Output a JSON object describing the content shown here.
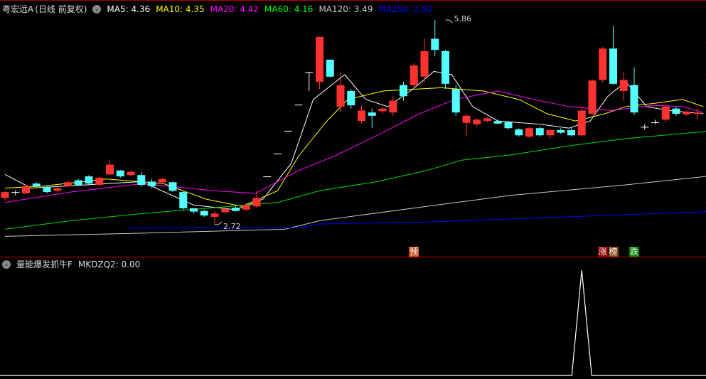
{
  "header": {
    "stock": "粤宏远A",
    "mode": "(日线 前复权)",
    "ma": [
      {
        "label": "MA5: 4.36",
        "color": "#ffffff"
      },
      {
        "label": "MA10: 4.35",
        "color": "#ffff00"
      },
      {
        "label": "MA20: 4.42",
        "color": "#ff00ff"
      },
      {
        "label": "MA60: 4.16",
        "color": "#00ff00"
      },
      {
        "label": "MA120: 3.49",
        "color": "#c8c8c8"
      },
      {
        "label": "MA250: 2.92",
        "color": "#0000ff"
      }
    ]
  },
  "indicator": {
    "name": "量能爆发抓牛F",
    "value_label": "MKDZQ2: 0.00",
    "series": {
      "spike_index": 55,
      "spike_value": 1
    }
  },
  "colors": {
    "up": "#ff3232",
    "down": "#54ffff"
  },
  "annotations": {
    "high": {
      "label": "5.86",
      "index": 42,
      "price": 5.86
    },
    "low": {
      "label": "2.72",
      "index": 20,
      "price": 2.72
    }
  },
  "markers": [
    {
      "label": "预",
      "index": 39,
      "color": "#c8501e"
    },
    {
      "label": "涨",
      "index": 57,
      "color": "#8b0000"
    },
    {
      "label": "榜",
      "index": 58,
      "color": "#8b4513"
    },
    {
      "label": "跌",
      "index": 60,
      "color": "#008000"
    }
  ],
  "chart_data": {
    "type": "candlestick",
    "price_range": [
      2.5,
      6.0
    ],
    "candles": [
      [
        3.13,
        3.22,
        3.24,
        3.09
      ],
      [
        3.22,
        3.22,
        3.25,
        3.17
      ],
      [
        3.2,
        3.31,
        3.33,
        3.18
      ],
      [
        3.35,
        3.31,
        3.37,
        3.3
      ],
      [
        3.3,
        3.22,
        3.31,
        3.2
      ],
      [
        3.24,
        3.28,
        3.3,
        3.22
      ],
      [
        3.31,
        3.37,
        3.4,
        3.3
      ],
      [
        3.4,
        3.33,
        3.42,
        3.31
      ],
      [
        3.46,
        3.35,
        3.48,
        3.33
      ],
      [
        3.33,
        3.44,
        3.46,
        3.31
      ],
      [
        3.49,
        3.64,
        3.71,
        3.48
      ],
      [
        3.55,
        3.46,
        3.56,
        3.44
      ],
      [
        3.48,
        3.53,
        3.55,
        3.46
      ],
      [
        3.48,
        3.33,
        3.53,
        3.3
      ],
      [
        3.38,
        3.31,
        3.42,
        3.28
      ],
      [
        3.37,
        3.42,
        3.44,
        3.35
      ],
      [
        3.37,
        3.24,
        3.38,
        3.22
      ],
      [
        3.22,
        2.97,
        3.24,
        2.95
      ],
      [
        2.97,
        2.92,
        2.98,
        2.89
      ],
      [
        2.93,
        2.86,
        2.95,
        2.84
      ],
      [
        2.84,
        2.89,
        2.93,
        2.72
      ],
      [
        2.91,
        2.96,
        2.98,
        2.89
      ],
      [
        2.98,
        2.93,
        3.0,
        2.92
      ],
      [
        2.95,
        3.02,
        3.04,
        2.93
      ],
      [
        3.0,
        3.13,
        3.24,
        2.98
      ],
      [
        3.46,
        3.46,
        3.46,
        3.46
      ],
      [
        3.81,
        3.81,
        3.81,
        3.81
      ],
      [
        4.16,
        4.16,
        4.16,
        4.16
      ],
      [
        4.56,
        4.56,
        4.56,
        4.56
      ],
      [
        5.06,
        5.06,
        5.06,
        4.77
      ],
      [
        4.91,
        5.6,
        5.6,
        4.8
      ],
      [
        5.25,
        4.99,
        5.25,
        4.97
      ],
      [
        4.53,
        4.86,
        5.06,
        4.44
      ],
      [
        4.77,
        4.55,
        4.8,
        4.5
      ],
      [
        4.31,
        4.47,
        4.55,
        4.27
      ],
      [
        4.44,
        4.39,
        4.5,
        4.2
      ],
      [
        4.46,
        4.5,
        4.53,
        4.42
      ],
      [
        4.44,
        4.62,
        4.69,
        4.39
      ],
      [
        4.86,
        4.69,
        4.91,
        4.62
      ],
      [
        4.86,
        5.16,
        5.2,
        4.8
      ],
      [
        4.99,
        5.38,
        5.57,
        4.91
      ],
      [
        5.57,
        5.4,
        5.86,
        5.3
      ],
      [
        5.38,
        4.88,
        5.4,
        4.8
      ],
      [
        4.8,
        4.44,
        4.86,
        4.39
      ],
      [
        4.28,
        4.39,
        4.42,
        4.07
      ],
      [
        4.26,
        4.33,
        4.35,
        4.22
      ],
      [
        4.31,
        4.35,
        4.37,
        4.29
      ],
      [
        4.31,
        4.27,
        4.33,
        4.26
      ],
      [
        4.29,
        4.2,
        4.31,
        4.18
      ],
      [
        4.18,
        4.09,
        4.2,
        4.07
      ],
      [
        4.07,
        4.2,
        4.22,
        4.05
      ],
      [
        4.2,
        4.09,
        4.22,
        4.07
      ],
      [
        4.09,
        4.17,
        4.18,
        4.05
      ],
      [
        4.17,
        4.13,
        4.2,
        4.11
      ],
      [
        4.17,
        4.09,
        4.2,
        4.07
      ],
      [
        4.09,
        4.47,
        4.5,
        4.07
      ],
      [
        4.42,
        4.93,
        4.95,
        4.4
      ],
      [
        4.94,
        5.42,
        5.45,
        4.9
      ],
      [
        5.42,
        4.88,
        5.77,
        4.86
      ],
      [
        4.77,
        4.94,
        5.06,
        4.62
      ],
      [
        4.86,
        4.44,
        5.13,
        4.4
      ],
      [
        4.22,
        4.22,
        4.26,
        4.18
      ],
      [
        4.29,
        4.29,
        4.33,
        4.26
      ],
      [
        4.33,
        4.53,
        4.56,
        4.29
      ],
      [
        4.5,
        4.42,
        4.53,
        4.39
      ],
      [
        4.41,
        4.45,
        4.47,
        4.39
      ],
      [
        4.42,
        4.44,
        4.5,
        4.33
      ]
    ],
    "ma_lines": [
      {
        "name": "MA5",
        "color": "#ffffff",
        "points": [
          [
            0,
            3.49
          ],
          [
            2.5,
            3.28
          ],
          [
            13,
            3.38
          ],
          [
            18,
            3.02
          ],
          [
            22,
            2.95
          ],
          [
            24.6,
            3.11
          ],
          [
            27.3,
            3.66
          ],
          [
            29.4,
            4.64
          ],
          [
            32.4,
            5.02
          ],
          [
            34.4,
            4.64
          ],
          [
            36.5,
            4.53
          ],
          [
            38.9,
            4.8
          ],
          [
            40.9,
            5.07
          ],
          [
            42.6,
            5.02
          ],
          [
            44.6,
            4.53
          ],
          [
            47,
            4.31
          ],
          [
            51,
            4.26
          ],
          [
            53.8,
            4.2
          ],
          [
            55.8,
            4.31
          ],
          [
            57.5,
            4.69
          ],
          [
            59.2,
            4.91
          ],
          [
            61.2,
            4.53
          ],
          [
            63.3,
            4.47
          ],
          [
            66.6,
            4.42
          ]
        ]
      },
      {
        "name": "MA10",
        "color": "#ffff00",
        "points": [
          [
            0,
            3.28
          ],
          [
            3.6,
            3.31
          ],
          [
            9.7,
            3.42
          ],
          [
            15.1,
            3.35
          ],
          [
            19.2,
            3.11
          ],
          [
            22.6,
            3.0
          ],
          [
            26,
            3.24
          ],
          [
            28,
            3.77
          ],
          [
            30.7,
            4.31
          ],
          [
            32.7,
            4.64
          ],
          [
            36.1,
            4.77
          ],
          [
            41.6,
            4.82
          ],
          [
            45.6,
            4.77
          ],
          [
            49,
            4.64
          ],
          [
            51.7,
            4.42
          ],
          [
            54.4,
            4.31
          ],
          [
            57.2,
            4.42
          ],
          [
            59.2,
            4.53
          ],
          [
            61.9,
            4.58
          ],
          [
            64.6,
            4.64
          ],
          [
            66.6,
            4.53
          ]
        ]
      },
      {
        "name": "MA20",
        "color": "#ff00ff",
        "points": [
          [
            0,
            3.06
          ],
          [
            6.3,
            3.22
          ],
          [
            13.1,
            3.35
          ],
          [
            19.9,
            3.24
          ],
          [
            23.9,
            3.2
          ],
          [
            28,
            3.55
          ],
          [
            31.4,
            3.77
          ],
          [
            35.5,
            4.09
          ],
          [
            39.5,
            4.42
          ],
          [
            42.9,
            4.64
          ],
          [
            47,
            4.77
          ],
          [
            50.4,
            4.64
          ],
          [
            53.8,
            4.53
          ],
          [
            57.8,
            4.47
          ],
          [
            61.9,
            4.55
          ],
          [
            64.6,
            4.53
          ],
          [
            66.6,
            4.44
          ]
        ]
      },
      {
        "name": "MA60",
        "color": "#00dd00",
        "points": [
          [
            0,
            2.65
          ],
          [
            6.3,
            2.78
          ],
          [
            13.1,
            2.89
          ],
          [
            19.9,
            2.98
          ],
          [
            26,
            3.06
          ],
          [
            30,
            3.24
          ],
          [
            35.5,
            3.38
          ],
          [
            40.2,
            3.55
          ],
          [
            43.6,
            3.71
          ],
          [
            48.3,
            3.79
          ],
          [
            53.8,
            3.93
          ],
          [
            59.2,
            4.04
          ],
          [
            66.9,
            4.15
          ]
        ]
      },
      {
        "name": "MA120",
        "color": "#c8c8c8",
        "points": [
          [
            0,
            2.54
          ],
          [
            13.1,
            2.59
          ],
          [
            26.7,
            2.65
          ],
          [
            30,
            2.78
          ],
          [
            40.2,
            3.0
          ],
          [
            48.3,
            3.17
          ],
          [
            59.2,
            3.33
          ],
          [
            66.9,
            3.46
          ]
        ]
      },
      {
        "name": "MA250",
        "color": "#0000ff",
        "points": [
          [
            11.7,
            2.67
          ],
          [
            28,
            2.67
          ],
          [
            30,
            2.73
          ],
          [
            40.2,
            2.76
          ],
          [
            53.8,
            2.84
          ],
          [
            66.9,
            2.92
          ]
        ]
      }
    ]
  }
}
